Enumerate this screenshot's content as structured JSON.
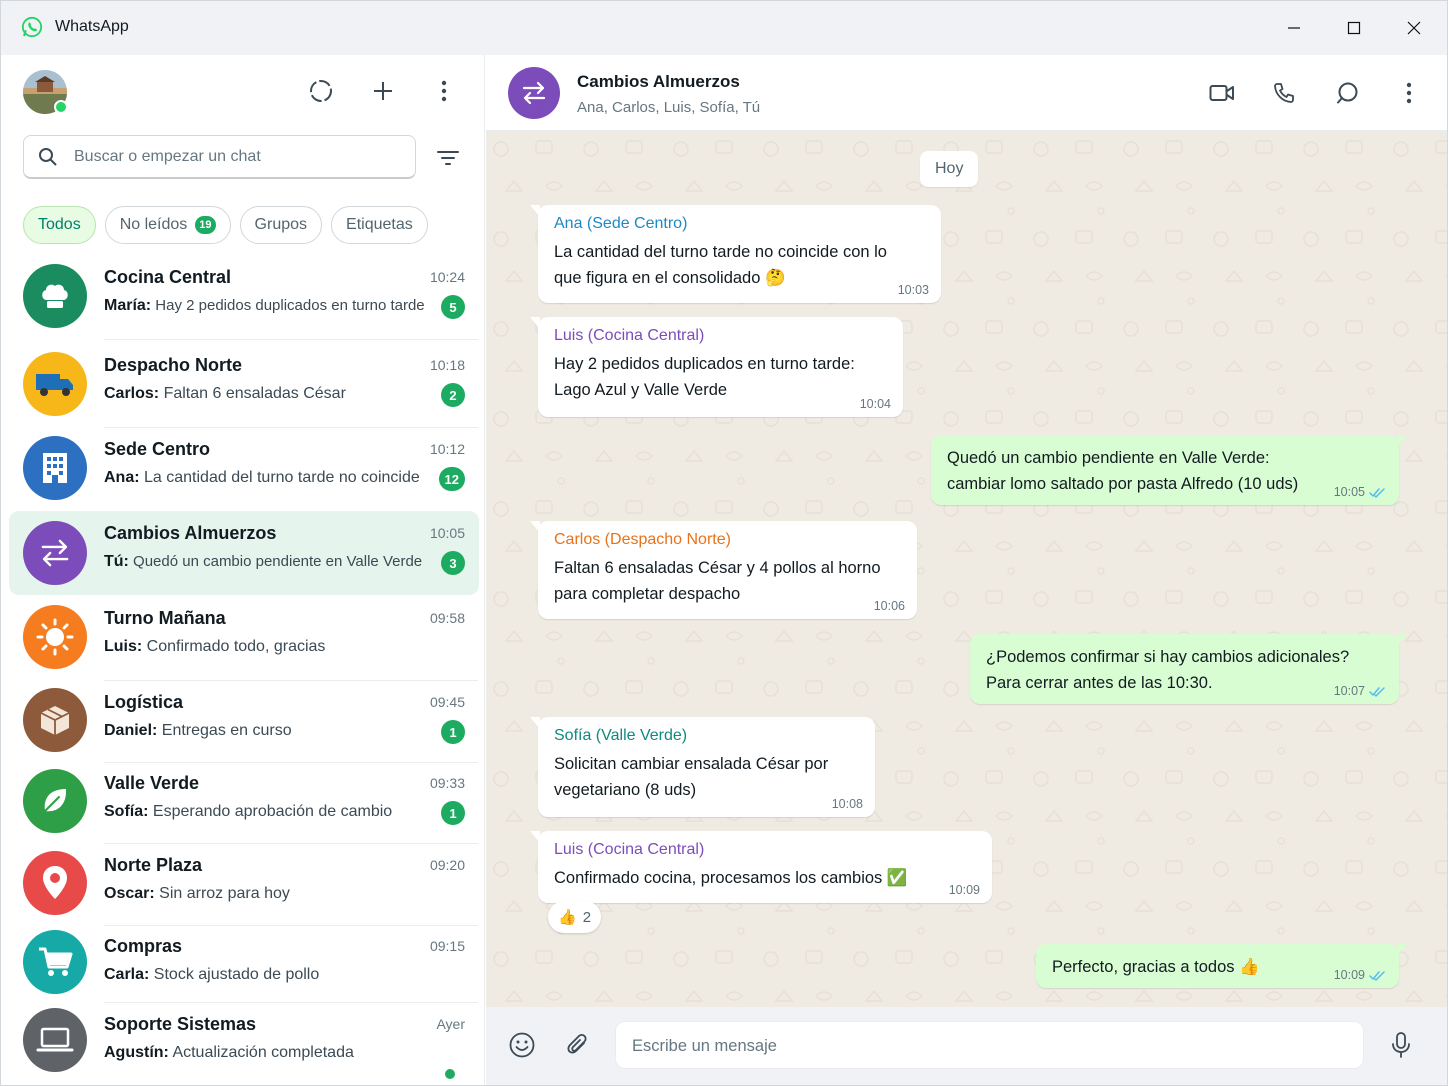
{
  "app": {
    "title": "WhatsApp"
  },
  "sidebar": {
    "search_placeholder": "Buscar o empezar un chat",
    "filters": [
      {
        "label": "Todos",
        "active": true
      },
      {
        "label": "No leídos",
        "count": "19"
      },
      {
        "label": "Grupos"
      },
      {
        "label": "Etiquetas"
      }
    ],
    "chats": [
      {
        "name": "Cocina Central",
        "time": "10:24",
        "sender": "María:",
        "preview": "Hay 2 pedidos duplicados en turno tarde",
        "unread": "5",
        "color": "#1a8c5f",
        "icon": "chef-hat-icon"
      },
      {
        "name": "Despacho Norte",
        "time": "10:18",
        "sender": "Carlos:",
        "preview": "Faltan 6 ensaladas César",
        "unread": "2",
        "color": "#f7b718",
        "icon": "truck-icon"
      },
      {
        "name": "Sede Centro",
        "time": "10:12",
        "sender": "Ana:",
        "preview": "La cantidad del turno tarde no coincide",
        "unread": "12",
        "color": "#2d6fc0",
        "icon": "building-icon"
      },
      {
        "name": "Cambios Almuerzos",
        "time": "10:05",
        "sender": "Tú:",
        "preview": "Quedó un cambio pendiente en Valle Verde",
        "unread": "3",
        "color": "#7c4dba",
        "icon": "swap-arrows-icon"
      },
      {
        "name": "Turno Mañana",
        "time": "09:58",
        "sender": "Luis:",
        "preview": "Confirmado todo, gracias",
        "unread": "",
        "color": "#f57c1f",
        "icon": "sun-icon"
      },
      {
        "name": "Logística",
        "time": "09:45",
        "sender": "Daniel:",
        "preview": "Entregas en curso",
        "unread": "1",
        "color": "#8d5a3b",
        "icon": "box-icon"
      },
      {
        "name": "Valle Verde",
        "time": "09:33",
        "sender": "Sofía:",
        "preview": "Esperando aprobación de cambio",
        "unread": "1",
        "color": "#2e9e47",
        "icon": "leaf-icon"
      },
      {
        "name": "Norte Plaza",
        "time": "09:20",
        "sender": "Oscar:",
        "preview": "Sin arroz para hoy",
        "unread": "",
        "color": "#e84a4a",
        "icon": "map-pin-icon"
      },
      {
        "name": "Compras",
        "time": "09:15",
        "sender": "Carla:",
        "preview": "Stock ajustado de pollo",
        "unread": "",
        "color": "#17a9a6",
        "icon": "cart-icon"
      },
      {
        "name": "Soporte Sistemas",
        "time": "Ayer",
        "sender": "Agustín:",
        "preview": "Actualización completada",
        "unread": "",
        "color": "#5f6368",
        "icon": "laptop-icon"
      }
    ]
  },
  "chat": {
    "title": "Cambios Almuerzos",
    "members": "Ana, Carlos, Luis, Sofía, Tú",
    "day": "Hoy",
    "messages": [
      {
        "dir": "in",
        "sender": "Ana (Sede Centro)",
        "sender_color": "#1e88c7",
        "lines": [
          "La cantidad del turno tarde no coincide con lo",
          "que figura en el consolidado 🤔"
        ],
        "time": "10:03"
      },
      {
        "dir": "in",
        "sender": "Luis (Cocina Central)",
        "sender_color": "#7c4dba",
        "lines": [
          "Hay 2 pedidos duplicados en turno tarde:",
          "Lago Azul y Valle Verde"
        ],
        "time": "10:04"
      },
      {
        "dir": "out",
        "lines": [
          "Quedó un cambio pendiente en Valle Verde:",
          "cambiar lomo saltado por pasta Alfredo (10 uds)"
        ],
        "time": "10:05"
      },
      {
        "dir": "in",
        "sender": "Carlos (Despacho Norte)",
        "sender_color": "#e8731a",
        "lines": [
          "Faltan 6 ensaladas César y 4 pollos al horno",
          "para completar despacho"
        ],
        "time": "10:06"
      },
      {
        "dir": "out",
        "lines": [
          "¿Podemos confirmar si hay cambios adicionales?",
          "Para cerrar antes de las 10:30."
        ],
        "time": "10:07"
      },
      {
        "dir": "in",
        "sender": "Sofía (Valle Verde)",
        "sender_color": "#0f8a7e",
        "lines": [
          "Solicitan cambiar ensalada César por",
          "vegetariano (8 uds)"
        ],
        "time": "10:08"
      },
      {
        "dir": "in",
        "sender": "Luis (Cocina Central)",
        "sender_color": "#7c4dba",
        "lines": [
          "Confirmado cocina, procesamos los cambios ✅"
        ],
        "time": "10:09",
        "reaction": {
          "emoji": "👍",
          "count": "2"
        }
      },
      {
        "dir": "out",
        "lines": [
          "Perfecto, gracias a todos 👍"
        ],
        "time": "10:09"
      }
    ]
  },
  "composer": {
    "placeholder": "Escribe un mensaje"
  },
  "colors": {
    "accent": "#1daa61",
    "teal": "#008069",
    "tick_blue": "#53bdeb",
    "out_bubble": "#d9fdd3",
    "chat_bg": "#efeae2"
  }
}
